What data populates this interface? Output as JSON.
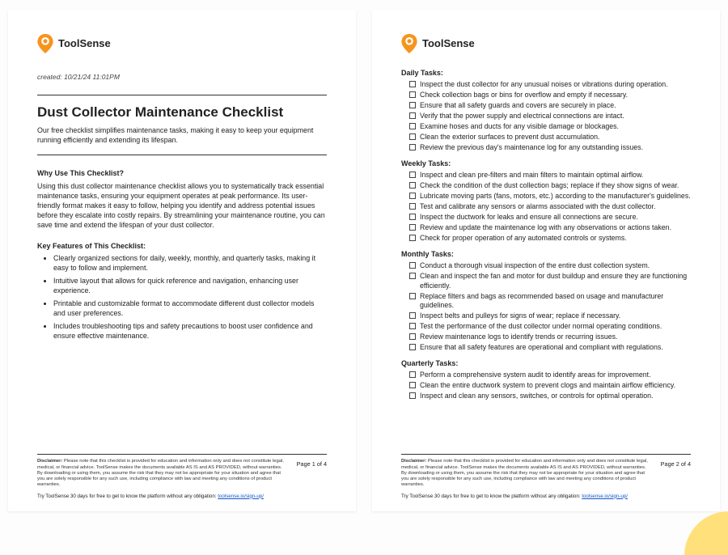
{
  "brand": {
    "name": "ToolSense",
    "accent": "#f7941e"
  },
  "created": "created: 10/21/24 11:01PM",
  "title": "Dust Collector Maintenance Checklist",
  "subtitle": "Our free checklist simplifies maintenance tasks, making it easy to keep your equipment running efficiently and extending its lifespan.",
  "why": {
    "heading": "Why Use This Checklist?",
    "body": "Using this dust collector maintenance checklist allows you to systematically track essential maintenance tasks, ensuring your equipment operates at peak performance. Its user-friendly format makes it easy to follow, helping you identify and address potential issues before they escalate into costly repairs. By streamlining your maintenance routine, you can save time and extend the lifespan of your dust collector."
  },
  "features": {
    "heading": "Key Features of This Checklist:",
    "items": [
      "Clearly organized sections for daily, weekly, monthly, and quarterly tasks, making it easy to follow and implement.",
      "Intuitive layout that allows for quick reference and navigation, enhancing user experience.",
      "Printable and customizable format to accommodate different dust collector models and user preferences.",
      "Includes troubleshooting tips and safety precautions to boost user confidence and ensure effective maintenance."
    ]
  },
  "task_groups": [
    {
      "title": "Daily Tasks:",
      "items": [
        "Inspect the dust collector for any unusual noises or vibrations during operation.",
        "Check collection bags or bins for overflow and empty if necessary.",
        "Ensure that all safety guards and covers are securely in place.",
        "Verify that the power supply and electrical connections are intact.",
        "Examine hoses and ducts for any visible damage or blockages.",
        "Clean the exterior surfaces to prevent dust accumulation.",
        "Review the previous day's maintenance log for any outstanding issues."
      ]
    },
    {
      "title": "Weekly Tasks:",
      "items": [
        "Inspect and clean pre-filters and main filters to maintain optimal airflow.",
        "Check the condition of the dust collection bags; replace if they show signs of wear.",
        "Lubricate moving parts (fans, motors, etc.) according to the manufacturer's guidelines.",
        "Test and calibrate any sensors or alarms associated with the dust collector.",
        "Inspect the ductwork for leaks and ensure all connections are secure.",
        "Review and update the maintenance log with any observations or actions taken.",
        "Check for proper operation of any automated controls or systems."
      ]
    },
    {
      "title": "Monthly Tasks:",
      "items": [
        "Conduct a thorough visual inspection of the entire dust collection system.",
        "Clean and inspect the fan and motor for dust buildup and ensure they are functioning efficiently.",
        "Replace filters and bags as recommended based on usage and manufacturer guidelines.",
        "Inspect belts and pulleys for signs of wear; replace if necessary.",
        "Test the performance of the dust collector under normal operating conditions.",
        "Review maintenance logs to identify trends or recurring issues.",
        "Ensure that all safety features are operational and compliant with regulations."
      ]
    },
    {
      "title": "Quarterly Tasks:",
      "items": [
        "Perform a comprehensive system audit to identify areas for improvement.",
        "Clean the entire ductwork system to prevent clogs and maintain airflow efficiency.",
        "Inspect and clean any sensors, switches, or controls for optimal operation."
      ]
    }
  ],
  "disclaimer_label": "Disclaimer:",
  "disclaimer": "Please note that this checklist is provided for education and information only and does not constitute legal, medical, or financial advice. ToolSense makes the documents available AS IS and AS PROVIDED, without warranties. By downloading or using them, you assume the risk that they may not be appropriate for your situation and agree that you are solely responsible for any such use, including compliance with law and meeting any conditions of product warranties.",
  "try_text": "Try ToolSense 30 days for free to get to know the platform without any obligation: ",
  "try_link": "toolsense.io/sign-up/",
  "page1": "Page 1 of 4",
  "page2": "Page 2 of 4"
}
